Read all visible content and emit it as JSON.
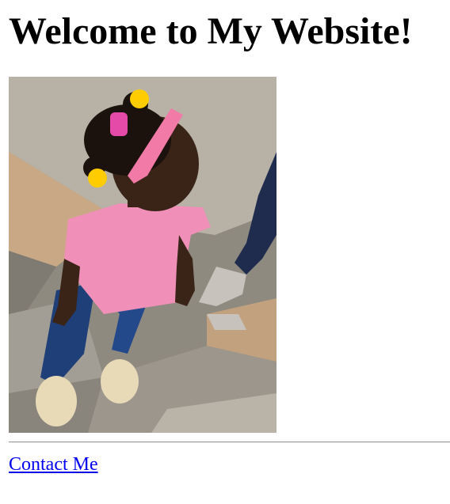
{
  "page": {
    "heading": "Welcome to My Website!",
    "contact_link": "Contact Me"
  },
  "colors": {
    "link": "#0000ee",
    "text": "#000000",
    "background": "#ffffff"
  }
}
